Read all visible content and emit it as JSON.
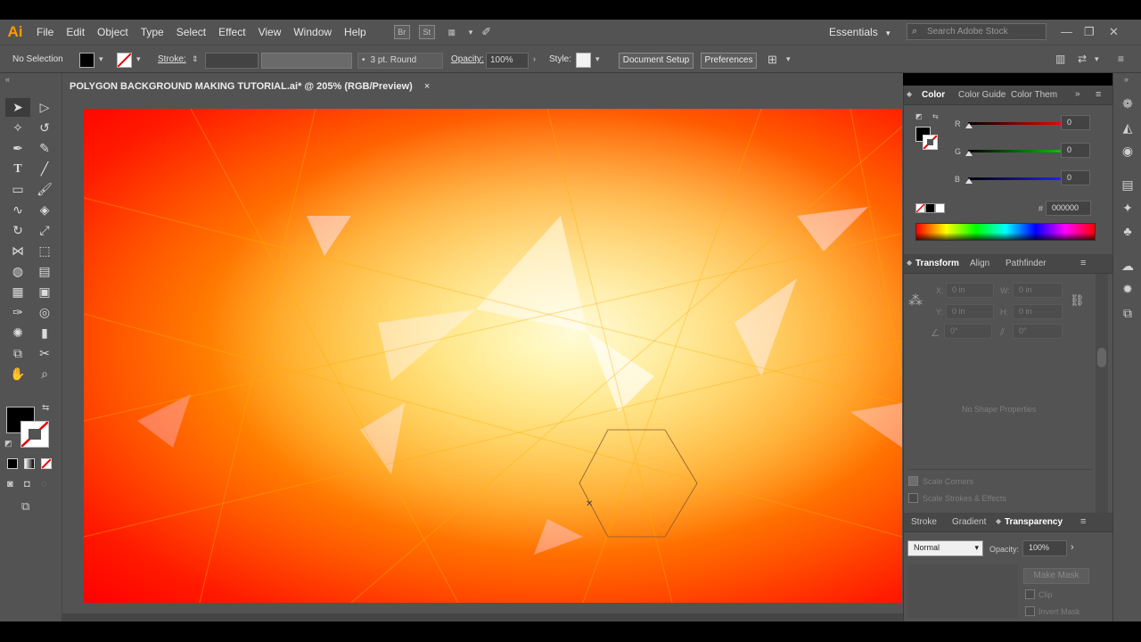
{
  "app": {
    "logo": "Ai",
    "menu": [
      "File",
      "Edit",
      "Object",
      "Type",
      "Select",
      "Effect",
      "View",
      "Window",
      "Help"
    ],
    "bridge_label": "Br",
    "stock_label": "St",
    "workspace": "Essentials",
    "search_placeholder": "Search Adobe Stock"
  },
  "control_bar": {
    "selection": "No Selection",
    "stroke_label": "Stroke:",
    "brush": "3 pt. Round",
    "opacity_label": "Opacity:",
    "opacity": "100%",
    "style_label": "Style:",
    "document_setup": "Document Setup",
    "preferences": "Preferences"
  },
  "document": {
    "tab_title": "POLYGON BACKGROUND MAKING TUTORIAL.ai* @ 205% (RGB/Preview)",
    "close_glyph": "×"
  },
  "color_panel": {
    "tabs": [
      "Color",
      "Color Guide",
      "Color Them"
    ],
    "r_label": "R",
    "r_value": "0",
    "g_label": "G",
    "g_value": "0",
    "b_label": "B",
    "b_value": "0",
    "hex_label": "#",
    "hex_value": "000000"
  },
  "transform_panel": {
    "tabs": [
      "Transform",
      "Align",
      "Pathfinder"
    ],
    "x_label": "X:",
    "x_value": "0 in",
    "y_label": "Y:",
    "y_value": "0 in",
    "w_label": "W:",
    "w_value": "0 in",
    "h_label": "H:",
    "h_value": "0 in",
    "rotate_value": "0°",
    "shear_value": "0°",
    "no_shape": "No Shape Properties",
    "scale_corners": "Scale Corners",
    "scale_strokes": "Scale Strokes & Effects"
  },
  "transparency_panel": {
    "tabs": [
      "Stroke",
      "Gradient",
      "Transparency"
    ],
    "blend_mode": "Normal",
    "opacity_label": "Opacity:",
    "opacity": "100%",
    "make_mask": "Make Mask",
    "clip": "Clip",
    "invert_mask": "Invert Mask"
  },
  "colors": {
    "accent_logo": "#ff9a00",
    "ui_gray": "#535353"
  }
}
